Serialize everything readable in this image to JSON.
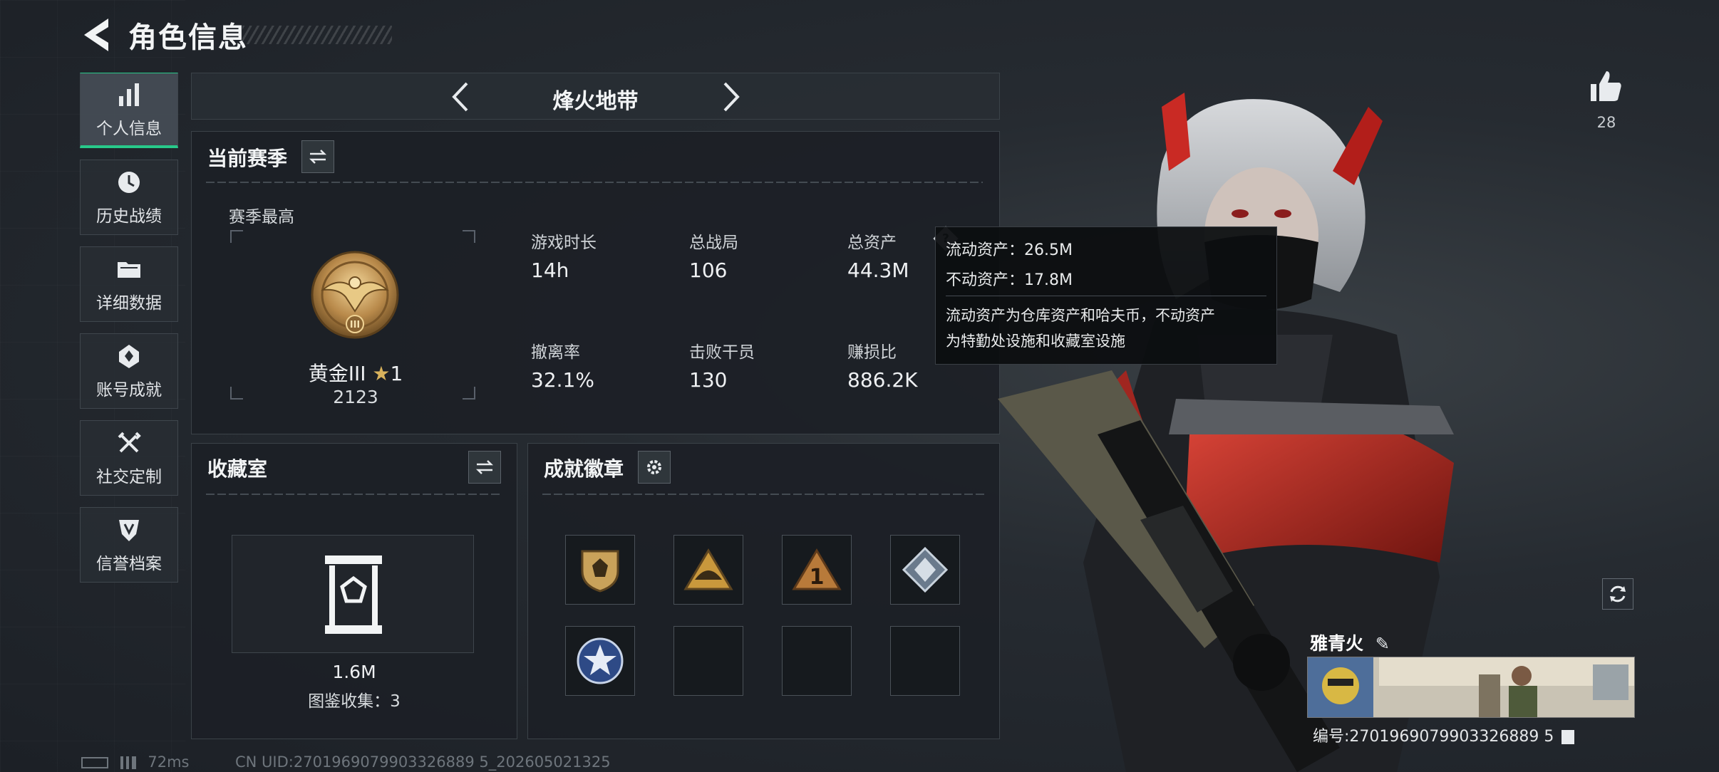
{
  "header": {
    "title": "角色信息"
  },
  "sidebar": {
    "items": [
      {
        "label": "个人信息",
        "icon": "bar-chart-icon",
        "active": true
      },
      {
        "label": "历史战绩",
        "icon": "clock-history-icon",
        "active": false
      },
      {
        "label": "详细数据",
        "icon": "folder-icon",
        "active": false
      },
      {
        "label": "账号成就",
        "icon": "achievement-icon",
        "active": false
      },
      {
        "label": "社交定制",
        "icon": "tools-icon",
        "active": false
      },
      {
        "label": "信誉档案",
        "icon": "shield-icon",
        "active": false
      }
    ]
  },
  "mode": {
    "name": "烽火地带"
  },
  "season": {
    "title": "当前赛季",
    "best_label": "赛季最高",
    "rank_name": "黄金III",
    "rank_stars": "1",
    "rank_score": "2123",
    "stats": [
      {
        "label": "游戏时长",
        "value": "14h"
      },
      {
        "label": "总战局",
        "value": "106"
      },
      {
        "label": "总资产",
        "value": "44.3M"
      },
      {
        "label": "撤离率",
        "value": "32.1%"
      },
      {
        "label": "击败干员",
        "value": "130"
      },
      {
        "label": "赚损比",
        "value": "886.2K"
      }
    ]
  },
  "tooltip": {
    "liquid": "流动资产：26.5M",
    "fixed": "不动资产：17.8M",
    "desc_line1": "流动资产为仓库资产和哈夫币，不动资产",
    "desc_line2": "为特勤处设施和收藏室设施"
  },
  "collection": {
    "title": "收藏室",
    "value": "1.6M",
    "count_text": "图鉴收集：3"
  },
  "badges": {
    "title": "成就徽章",
    "items": [
      {
        "icon": "shield-badge-icon",
        "filled": true
      },
      {
        "icon": "helmet-triangle-badge-icon",
        "filled": true
      },
      {
        "icon": "number-one-triangle-badge-icon",
        "filled": true
      },
      {
        "icon": "diamond-badge-icon",
        "filled": true
      },
      {
        "icon": "star-circle-badge-icon",
        "filled": true
      },
      {
        "icon": "",
        "filled": false
      },
      {
        "icon": "",
        "filled": false
      },
      {
        "icon": "",
        "filled": false
      }
    ]
  },
  "profile": {
    "like_count": "28",
    "player_name": "雅青火",
    "player_id": "编号:2701969079903326889 5",
    "uid_text": "CN UID:2701969079903326889 5_202605021325",
    "ping": "72ms"
  },
  "colors": {
    "accent": "#28c98a",
    "gold": "#c9a25a",
    "tooltip_bg": "#0c0e10"
  }
}
